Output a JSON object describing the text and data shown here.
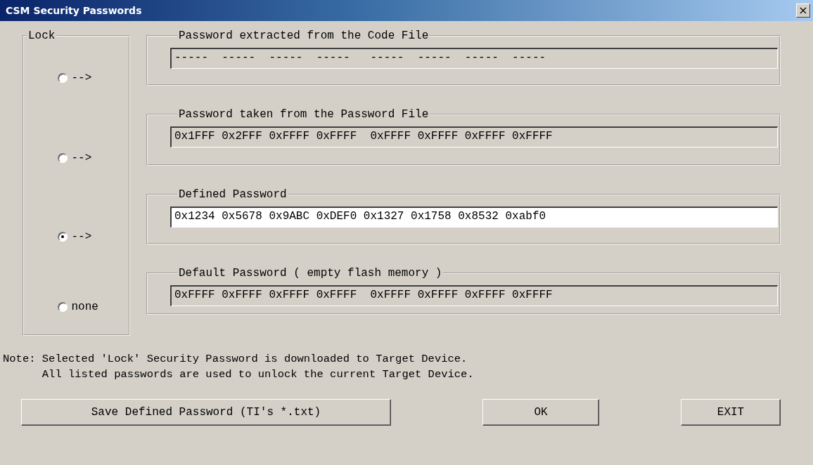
{
  "window": {
    "title": "CSM Security Passwords",
    "close": "×"
  },
  "lock": {
    "title": "Lock"
  },
  "rows": [
    {
      "radio": {
        "label": "-->",
        "selected": false
      },
      "group": "Password extracted from the Code File",
      "field": {
        "value": "-----  -----  -----  -----   -----  -----  -----  -----",
        "editable": false
      }
    },
    {
      "radio": {
        "label": "-->",
        "selected": false
      },
      "group": "Password taken from the Password File",
      "field": {
        "value": "0x1FFF 0x2FFF 0xFFFF 0xFFFF  0xFFFF 0xFFFF 0xFFFF 0xFFFF",
        "editable": false
      }
    },
    {
      "radio": {
        "label": "-->",
        "selected": true
      },
      "group": "Defined Password",
      "field": {
        "value": "0x1234 0x5678 0x9ABC 0xDEF0 0x1327 0x1758 0x8532 0xabf0",
        "editable": true
      }
    },
    {
      "radio": {
        "label": "none",
        "selected": false
      },
      "group": "Default Password ( empty flash memory )",
      "field": {
        "value": "0xFFFF 0xFFFF 0xFFFF 0xFFFF  0xFFFF 0xFFFF 0xFFFF 0xFFFF",
        "editable": false
      }
    }
  ],
  "note": [
    "Note: Selected 'Lock' Security Password is downloaded to Target Device.",
    "      All listed passwords are used to unlock the current Target Device."
  ],
  "buttons": [
    "Save Defined Password (TI's *.txt)",
    "OK",
    "EXIT"
  ]
}
